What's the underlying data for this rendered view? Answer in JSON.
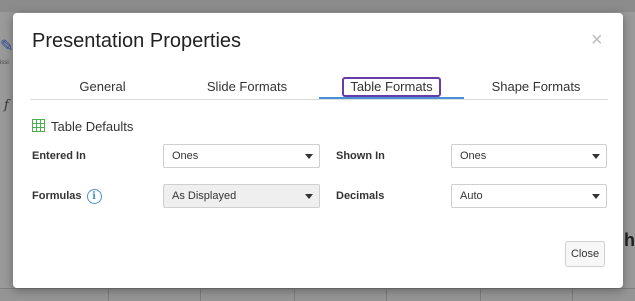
{
  "background": {
    "tiny_text": "issi",
    "formula_glyph": "f",
    "edge_text": "h"
  },
  "dialog": {
    "title": "Presentation Properties",
    "close_glyph": "×",
    "tabs": [
      {
        "label": "General"
      },
      {
        "label": "Slide Formats"
      },
      {
        "label": "Table Formats",
        "active": true
      },
      {
        "label": "Shape Formats"
      }
    ],
    "section_title": "Table Defaults",
    "fields": {
      "entered_in": {
        "label": "Entered In",
        "value": "Ones"
      },
      "shown_in": {
        "label": "Shown In",
        "value": "Ones"
      },
      "formulas": {
        "label": "Formulas",
        "value": "As Displayed",
        "info_glyph": "i"
      },
      "decimals": {
        "label": "Decimals",
        "value": "Auto"
      }
    },
    "close_button": "Close"
  },
  "colors": {
    "active_tab_underline": "#4a90d9",
    "active_tab_focus": "#6a3aa8",
    "table_icon": "#4caf50"
  }
}
